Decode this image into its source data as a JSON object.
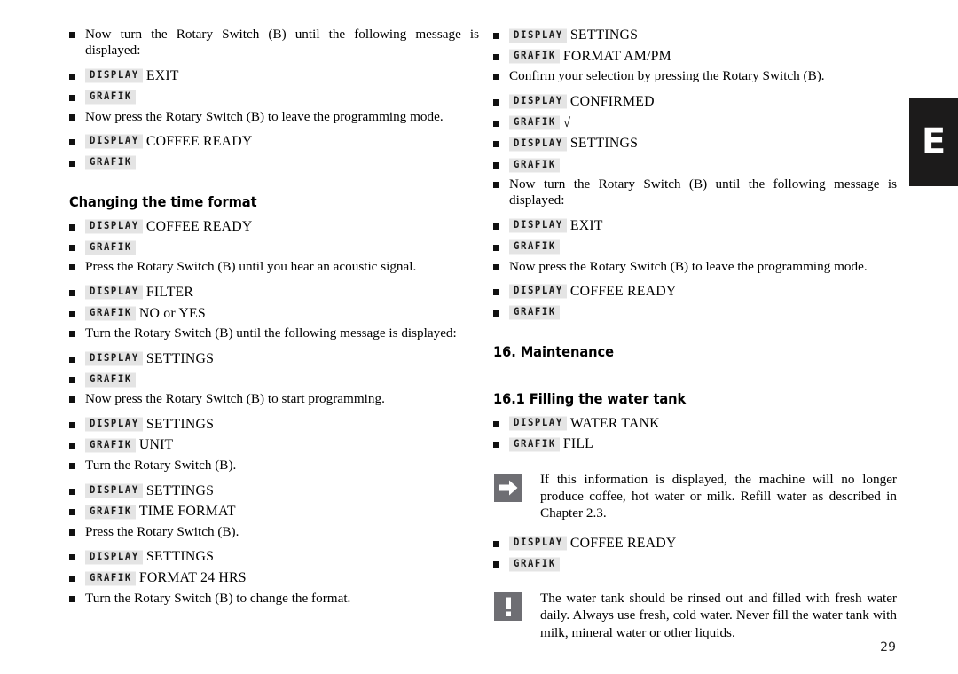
{
  "document": {
    "page_number": "29",
    "edge_tab_letter": "E"
  },
  "left_column": {
    "blocks": [
      {
        "kind": "para",
        "text": "Now turn the Rotary Switch (B) until the following message is displayed:"
      },
      {
        "kind": "tagline",
        "tag": "DISPLAY",
        "value": "EXIT"
      },
      {
        "kind": "tagline",
        "tag": "GRAFIK",
        "value": ""
      },
      {
        "kind": "para",
        "text": "Now press the Rotary Switch (B) to leave the programming mode."
      },
      {
        "kind": "tagline",
        "tag": "DISPLAY",
        "value": "COFFEE READY"
      },
      {
        "kind": "tagline",
        "tag": "GRAFIK",
        "value": ""
      },
      {
        "kind": "heading",
        "text": "Changing the time format"
      },
      {
        "kind": "tagline",
        "tag": "DISPLAY",
        "value": "COFFEE READY"
      },
      {
        "kind": "tagline",
        "tag": "GRAFIK",
        "value": ""
      },
      {
        "kind": "para",
        "text": "Press the Rotary Switch (B) until you hear an acoustic signal."
      },
      {
        "kind": "tagline",
        "tag": "DISPLAY",
        "value": "FILTER"
      },
      {
        "kind": "tagline",
        "tag": "GRAFIK",
        "value": "NO or YES"
      },
      {
        "kind": "para",
        "text": "Turn the Rotary Switch (B) until the following message is displayed:"
      },
      {
        "kind": "tagline",
        "tag": "DISPLAY",
        "value": "SETTINGS"
      },
      {
        "kind": "tagline",
        "tag": "GRAFIK",
        "value": ""
      },
      {
        "kind": "para",
        "text": "Now press the Rotary Switch (B) to start programming."
      },
      {
        "kind": "tagline",
        "tag": "DISPLAY",
        "value": "SETTINGS"
      },
      {
        "kind": "tagline",
        "tag": "GRAFIK",
        "value": "UNIT"
      },
      {
        "kind": "para",
        "text": "Turn the Rotary Switch (B)."
      },
      {
        "kind": "tagline",
        "tag": "DISPLAY",
        "value": "SETTINGS"
      },
      {
        "kind": "tagline",
        "tag": "GRAFIK",
        "value": "TIME FORMAT"
      },
      {
        "kind": "para",
        "text": "Press the Rotary Switch (B)."
      },
      {
        "kind": "tagline",
        "tag": "DISPLAY",
        "value": "SETTINGS"
      },
      {
        "kind": "tagline",
        "tag": "GRAFIK",
        "value": "FORMAT 24 HRS"
      },
      {
        "kind": "para",
        "text": "Turn the Rotary Switch (B) to change the format."
      }
    ]
  },
  "right_column": {
    "blocks": [
      {
        "kind": "tagline",
        "tag": "DISPLAY",
        "value": "SETTINGS"
      },
      {
        "kind": "tagline",
        "tag": "GRAFIK",
        "value": "FORMAT AM/PM"
      },
      {
        "kind": "para",
        "text": "Confirm your selection by pressing the Rotary Switch (B)."
      },
      {
        "kind": "tagline",
        "tag": "DISPLAY",
        "value": "CONFIRMED"
      },
      {
        "kind": "tagline",
        "tag": "GRAFIK",
        "value": "√",
        "symbol": true
      },
      {
        "kind": "tagline",
        "tag": "DISPLAY",
        "value": "SETTINGS"
      },
      {
        "kind": "tagline",
        "tag": "GRAFIK",
        "value": ""
      },
      {
        "kind": "para",
        "text": "Now turn the Rotary Switch (B) until the following message is displayed:"
      },
      {
        "kind": "tagline",
        "tag": "DISPLAY",
        "value": "EXIT"
      },
      {
        "kind": "tagline",
        "tag": "GRAFIK",
        "value": ""
      },
      {
        "kind": "para",
        "text": "Now press the Rotary Switch (B) to leave the programming mode."
      },
      {
        "kind": "tagline",
        "tag": "DISPLAY",
        "value": "COFFEE READY"
      },
      {
        "kind": "tagline",
        "tag": "GRAFIK",
        "value": ""
      },
      {
        "kind": "heading",
        "text": "16. Maintenance"
      },
      {
        "kind": "heading2",
        "text": "16.1 Filling the water tank"
      },
      {
        "kind": "tagline",
        "tag": "DISPLAY",
        "value": "WATER TANK"
      },
      {
        "kind": "tagline",
        "tag": "GRAFIK",
        "value": "FILL"
      },
      {
        "kind": "note",
        "icon": "arrow-right-icon",
        "text": "If this information is displayed, the machine will no longer produce coffee, hot water or milk. Refill water as described in Chapter 2.3."
      },
      {
        "kind": "tagline",
        "tag": "DISPLAY",
        "value": "COFFEE READY"
      },
      {
        "kind": "tagline",
        "tag": "GRAFIK",
        "value": ""
      },
      {
        "kind": "note",
        "icon": "exclamation-icon",
        "text": "The water tank should be rinsed out and filled with fresh water daily. Always use fresh, cold water. Never fill the water tank with milk, mineral water or other liquids."
      }
    ]
  },
  "colors": {
    "tag_background": "#e4e4e4",
    "icon_background": "#6e6e73",
    "edge_tab_background": "#1c1b1b",
    "text": "#000000"
  }
}
